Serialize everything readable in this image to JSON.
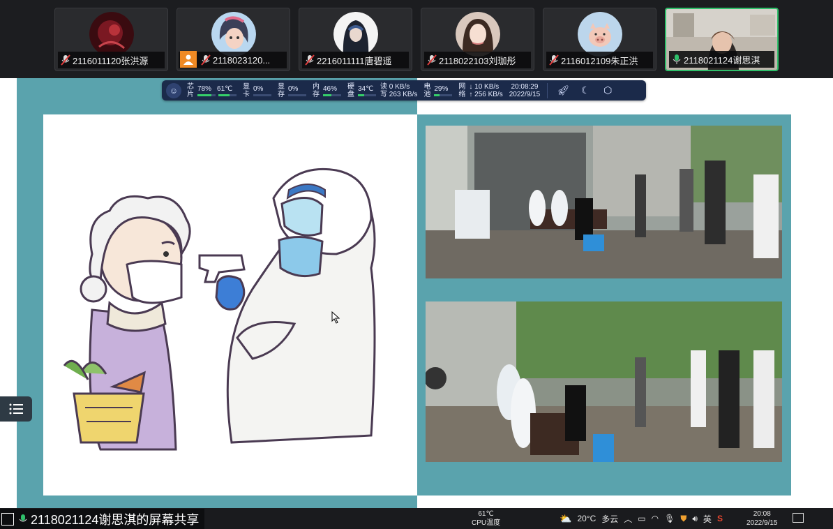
{
  "participants": [
    {
      "name": "2116011120张洪源",
      "mic": "muted",
      "avatar": "dark-red-avatar",
      "active": false
    },
    {
      "name": "2118023120...",
      "mic": "muted",
      "avatar": "anime-girl-avatar",
      "active": false,
      "badge": "person-icon"
    },
    {
      "name": "2216011111唐碧遥",
      "mic": "muted",
      "avatar": "hooded-girl-avatar",
      "active": false
    },
    {
      "name": "2118022103刘珈彤",
      "mic": "muted",
      "avatar": "girl-photo-avatar",
      "active": false
    },
    {
      "name": "2116012109朱正洪",
      "mic": "muted",
      "avatar": "pig-avatar",
      "active": false
    },
    {
      "name": "2118021124谢思淇",
      "mic": "on",
      "avatar": "camera-video",
      "active": true
    }
  ],
  "monitor": {
    "chip_label": [
      "芯",
      "片"
    ],
    "chip_usage": "78%",
    "chip_usage_level": 0.78,
    "chip_temp": "61℃",
    "chip_temp_level": 0.61,
    "gpu_label": [
      "显",
      "卡"
    ],
    "gpu_usage": "0%",
    "vram_label": [
      "显",
      "存"
    ],
    "vram_usage": "0%",
    "mem_label": [
      "内",
      "存"
    ],
    "mem_usage": "46%",
    "mem_usage_level": 0.46,
    "disk_label": [
      "硬",
      "盘"
    ],
    "disk_temp": "34℃",
    "disk_level": 0.34,
    "disk_read": "读 0 KB/s",
    "disk_write": "写 263 KB/s",
    "battery_label": [
      "电",
      "池"
    ],
    "battery": "29%",
    "battery_level": 0.29,
    "net_label": [
      "网",
      "络"
    ],
    "net_down": "↓ 10 KB/s",
    "net_up": "↑ 256 KB/s",
    "time": "20:08:29",
    "date": "2022/9/15"
  },
  "screen_share": {
    "presenter_label": "2118021124谢思淇的屏幕共享"
  },
  "taskbar": {
    "cpu_temp": "61℃",
    "cpu_label": "CPU温度",
    "weather_temp": "20°C",
    "weather_desc": "多云",
    "ime": "英",
    "time": "20:08",
    "date": "2022/9/15"
  },
  "colors": {
    "accent": "#2fbf6a",
    "slide_teal": "#5aa3ad",
    "monitor_bg": "#1b2a4a"
  }
}
